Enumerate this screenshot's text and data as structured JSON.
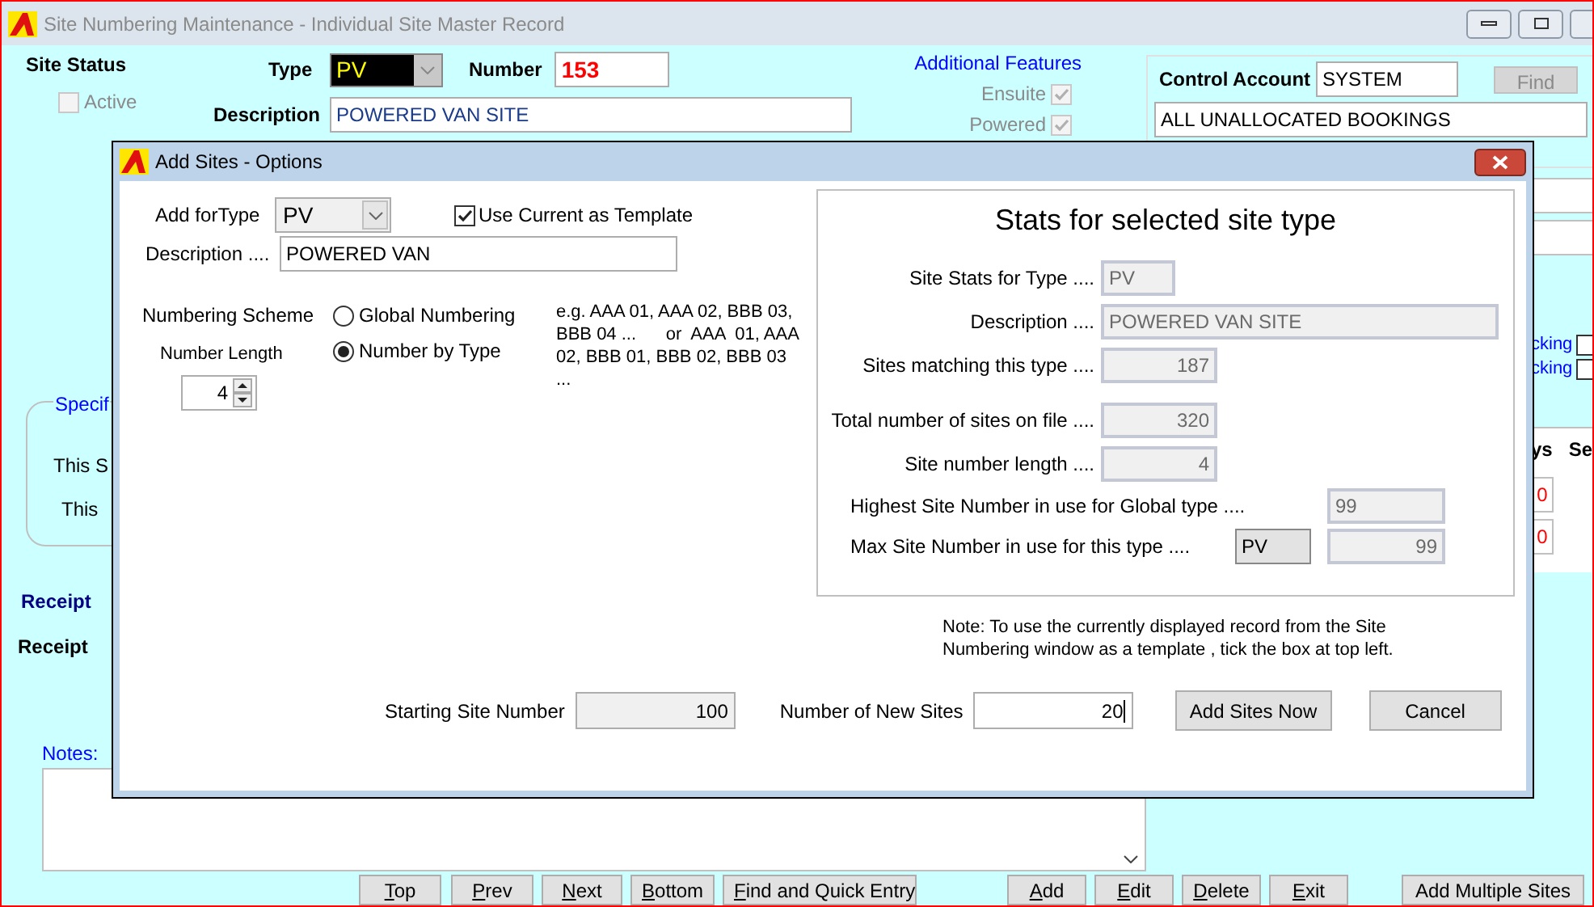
{
  "window": {
    "title": "Site Numbering Maintenance - Individual Site Master Record"
  },
  "site_status": {
    "label": "Site Status",
    "active": {
      "label": "Active",
      "checked": false,
      "disabled": true
    }
  },
  "type": {
    "label": "Type",
    "value": "PV"
  },
  "number": {
    "label": "Number",
    "value": "153"
  },
  "description": {
    "label": "Description",
    "value": "POWERED VAN SITE"
  },
  "additional_features": {
    "title": "Additional Features",
    "items": [
      {
        "label": "Ensuite",
        "checked": true
      },
      {
        "label": "Powered",
        "checked": true
      }
    ]
  },
  "control_account": {
    "label": "Control Account",
    "value": "SYSTEM",
    "find": {
      "label": "Find",
      "disabled": true
    },
    "name": "ALL UNALLOCATED BOOKINGS"
  },
  "right_edge": {
    "checks": [
      {
        "label": "cking",
        "checked": false
      },
      {
        "label": "cking",
        "checked": false
      }
    ],
    "table_headers": [
      "ys",
      "Se"
    ],
    "cells": [
      "0",
      "0"
    ]
  },
  "specific_group": {
    "legend": "Specif",
    "lines": [
      "This S",
      "This"
    ]
  },
  "receipt_lines": [
    "Receipt",
    "Receipt"
  ],
  "notes": {
    "label": "Notes:"
  },
  "buttons": [
    {
      "label": "Top",
      "mnemonic": true
    },
    {
      "label": "Prev",
      "mnemonic": true
    },
    {
      "label": "Next",
      "mnemonic": true
    },
    {
      "label": "Bottom",
      "mnemonic": true
    },
    {
      "label": "Find and Quick Entry",
      "mnemonic": true
    },
    {
      "label": "Add",
      "mnemonic": true
    },
    {
      "label": "Edit",
      "mnemonic": true
    },
    {
      "label": "Delete",
      "mnemonic": true
    },
    {
      "label": "Exit",
      "mnemonic": true
    },
    {
      "label": "Add Multiple Sites",
      "mnemonic": false
    }
  ],
  "dialog": {
    "title": "Add Sites - Options",
    "add_for_type": {
      "label": "Add forType",
      "value": "PV"
    },
    "use_template": {
      "label": "Use Current as Template",
      "checked": true
    },
    "description": {
      "label": "Description ....",
      "value": "POWERED VAN"
    },
    "numbering_scheme": {
      "label": "Numbering Scheme",
      "options": [
        {
          "label": "Global Numbering",
          "selected": false
        },
        {
          "label": "Number by Type",
          "selected": true
        }
      ]
    },
    "number_length": {
      "label": "Number Length",
      "value": "4"
    },
    "example": "e.g. AAA 01, AAA 02, BBB 03, BBB 04 ...      or  AAA  01, AAA 02, BBB 01, BBB 02, BBB 03 ...",
    "stats": {
      "title": "Stats for selected site type",
      "rows": [
        {
          "label": "Site Stats for Type ....",
          "value": "PV",
          "kind": "short"
        },
        {
          "label": "Description ....",
          "value": "POWERED VAN SITE",
          "kind": "wide"
        },
        {
          "label": "Sites matching this type ....",
          "value": "187",
          "kind": "number"
        },
        {
          "label": "Total number of sites on file ....",
          "value": "320",
          "kind": "number"
        },
        {
          "label": "Site number length ....",
          "value": "4",
          "kind": "number"
        }
      ],
      "highest": {
        "label": "Highest Site Number in use for Global type ....",
        "value": "99"
      },
      "max": {
        "label": "Max Site Number  in use for this type ....",
        "type": "PV",
        "value": "99"
      }
    },
    "note": "Note: To use the currently displayed record from the Site Numbering window as a template , tick the box at top left.",
    "starting": {
      "label": "Starting Site Number",
      "value": "100"
    },
    "new_sites": {
      "label": "Number of New Sites",
      "value": "20"
    },
    "add_button": "Add Sites Now",
    "cancel_button": "Cancel"
  }
}
